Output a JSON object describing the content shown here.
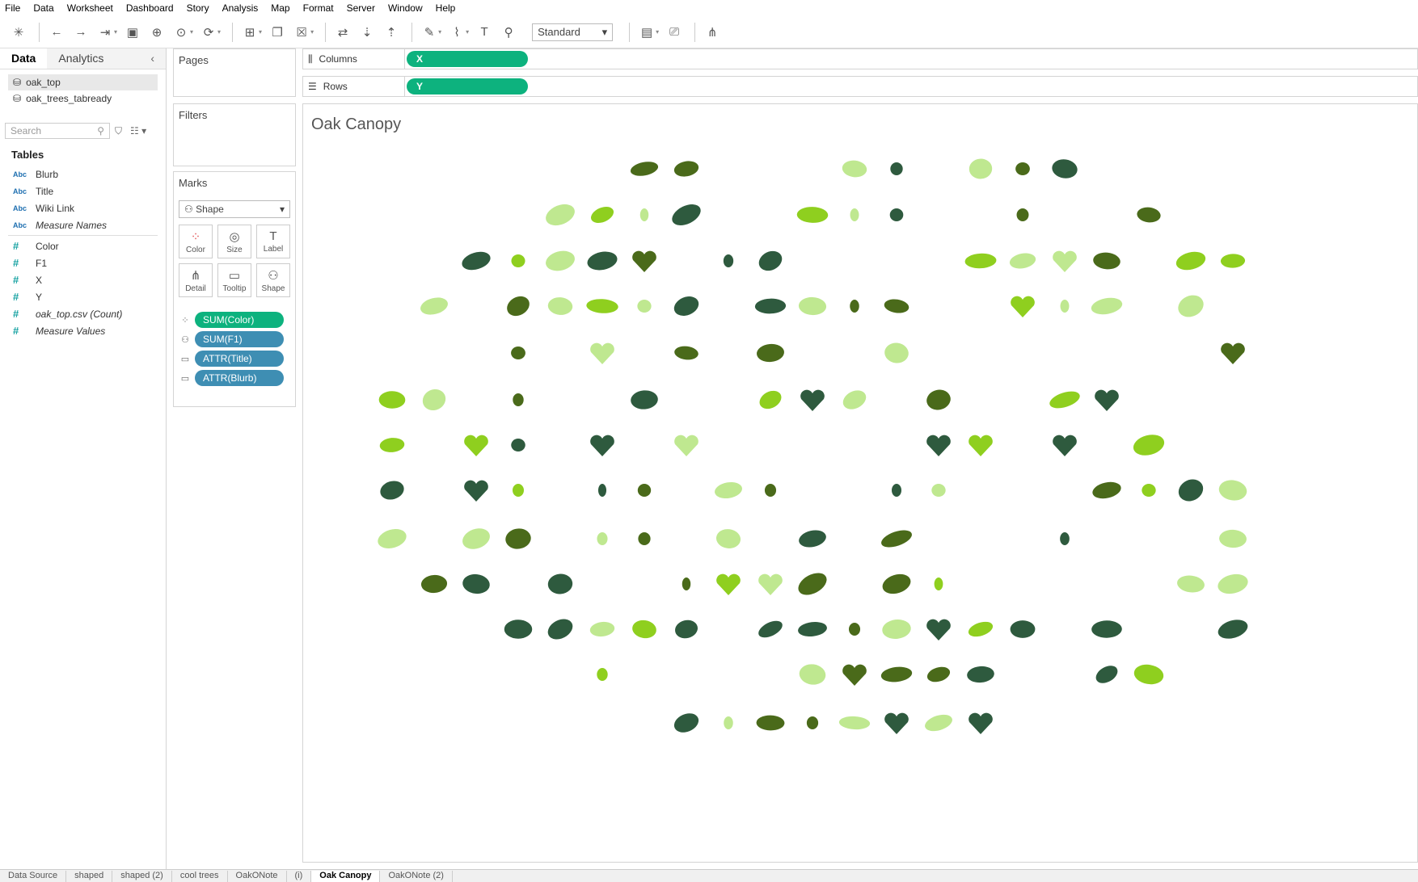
{
  "menu": [
    "File",
    "Data",
    "Worksheet",
    "Dashboard",
    "Story",
    "Analysis",
    "Map",
    "Format",
    "Server",
    "Window",
    "Help"
  ],
  "toolbar": {
    "fit_label": "Standard"
  },
  "left_tabs": {
    "data": "Data",
    "analytics": "Analytics"
  },
  "datasources": [
    "oak_top",
    "oak_trees_tabready"
  ],
  "search_placeholder": "Search",
  "tables_label": "Tables",
  "dimensions": [
    "Blurb",
    "Title",
    "Wiki Link",
    "Measure Names"
  ],
  "measures": [
    "Color",
    "F1",
    "X",
    "Y",
    "oak_top.csv (Count)",
    "Measure Values"
  ],
  "cards": {
    "pages": "Pages",
    "filters": "Filters",
    "marks": "Marks"
  },
  "marks": {
    "type": "Shape",
    "buttons": [
      "Color",
      "Size",
      "Label",
      "Detail",
      "Tooltip",
      "Shape"
    ],
    "pills": [
      {
        "label": "SUM(Color)",
        "color": "#0db27e"
      },
      {
        "label": "SUM(F1)",
        "color": "#3e8eb3"
      },
      {
        "label": "ATTR(Title)",
        "color": "#3e8eb3"
      },
      {
        "label": "ATTR(Blurb)",
        "color": "#3e8eb3"
      }
    ]
  },
  "shelves": {
    "columns_label": "Columns",
    "columns_pill": "X",
    "rows_label": "Rows",
    "rows_pill": "Y"
  },
  "view_title": "Oak Canopy",
  "sheet_tabs": [
    "Data Source",
    "shaped",
    "shaped (2)",
    "cool trees",
    "OakONote",
    "(i)",
    "Oak Canopy",
    "OakONote (2)"
  ],
  "current_tab": "Oak Canopy",
  "palette": [
    "#2e5a3e",
    "#4a6a1a",
    "#8fcf1f",
    "#bfe890"
  ]
}
